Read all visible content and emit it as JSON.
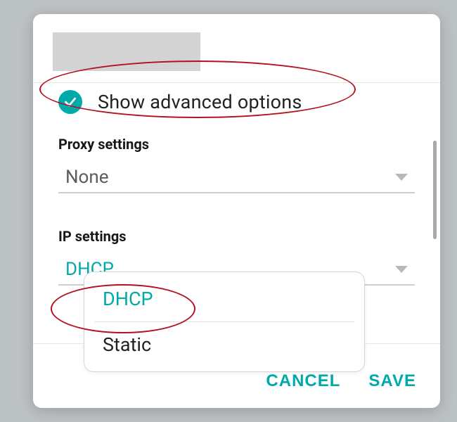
{
  "colors": {
    "accent": "#00a9aa",
    "annotation": "#b3111e"
  },
  "advanced": {
    "label": "Show advanced options",
    "checked": true
  },
  "proxy": {
    "section_label": "Proxy settings",
    "selected": "None"
  },
  "ip": {
    "section_label": "IP settings",
    "selected": "DHCP",
    "options": [
      "DHCP",
      "Static"
    ]
  },
  "actions": {
    "cancel": "CANCEL",
    "save": "SAVE"
  }
}
